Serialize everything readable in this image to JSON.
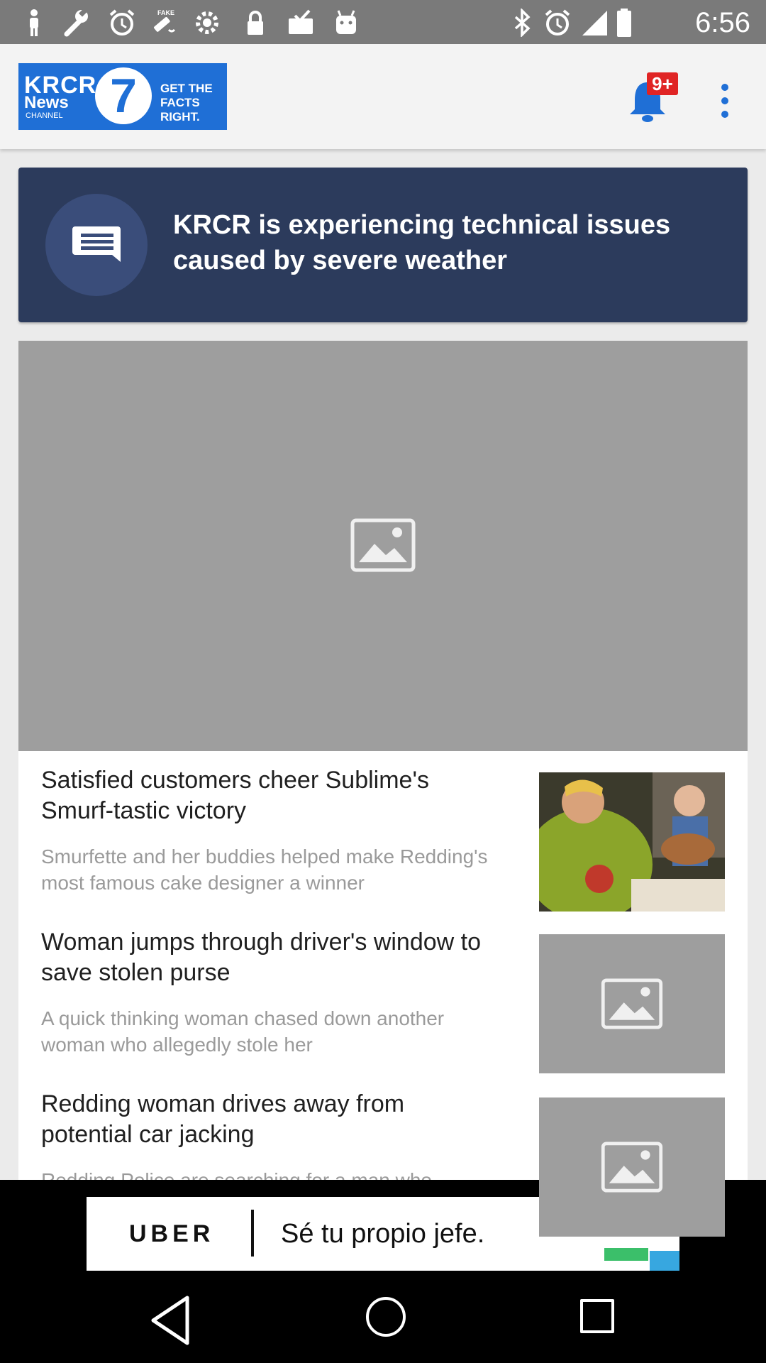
{
  "status_bar": {
    "time": "6:56",
    "fake_gps_label": "FAKE"
  },
  "app_bar": {
    "logo": {
      "line1": "KRCR",
      "line2": "News",
      "line3": "CHANNEL",
      "channel_number": "7",
      "tagline_1": "GET THE",
      "tagline_2": "FACTS RIGHT."
    },
    "notification_count": "9+"
  },
  "alert_banner": {
    "text": "KRCR is experiencing technical issues caused by severe weather"
  },
  "news_items": [
    {
      "title": "Satisfied customers cheer Sublime's Smurf-tastic victory",
      "summary": "Smurfette and her buddies helped make Redding's most famous cake designer a winner"
    },
    {
      "title": "Woman jumps through driver's window to save stolen purse",
      "summary": "A quick thinking woman chased down another woman who allegedly stole her"
    },
    {
      "title": "Redding woman drives away from potential car jacking",
      "summary": "Redding Police are searching for a man who"
    }
  ],
  "ad": {
    "brand": "UBER",
    "text": "Sé tu propio jefe."
  },
  "colors": {
    "brand_blue": "#1f6fd6",
    "banner_navy": "#2c3b5c",
    "badge_red": "#e02424",
    "placeholder_gray": "#9e9e9e"
  }
}
